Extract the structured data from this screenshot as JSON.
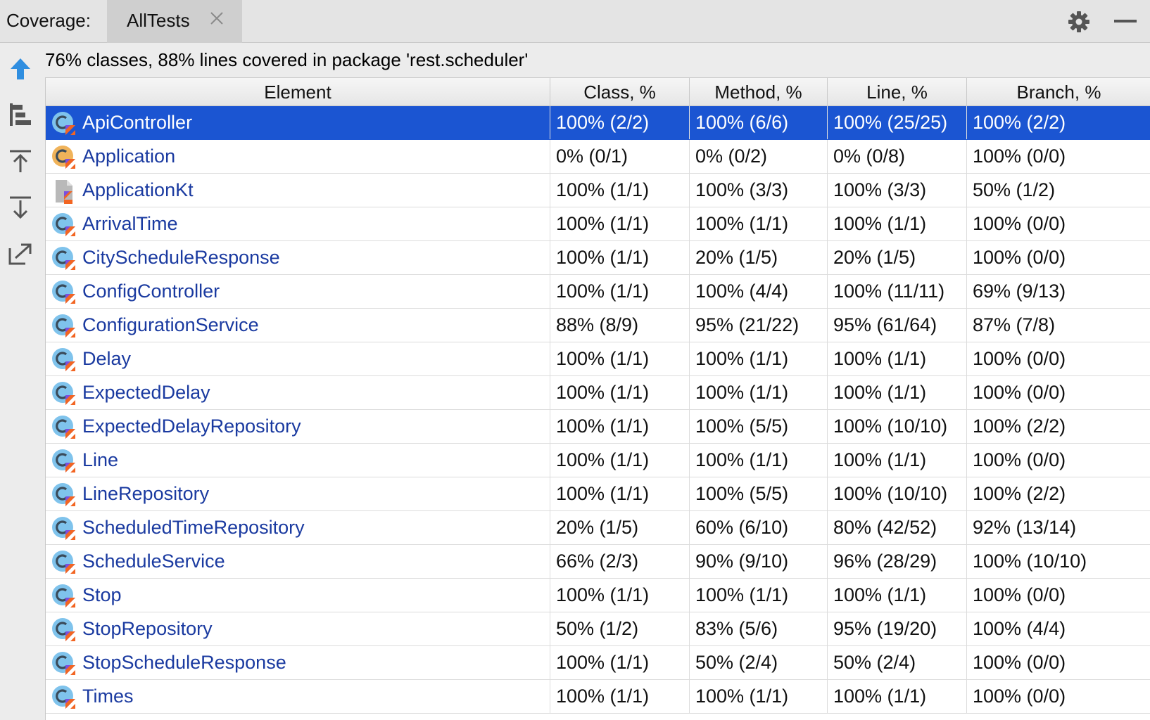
{
  "header": {
    "title": "Coverage:",
    "tab_label": "AllTests"
  },
  "icons": {
    "tab_close": "close-icon",
    "settings": "gear-icon",
    "minimize": "minimize-icon",
    "toolbar": [
      "arrow-up-icon",
      "flatten-packages-icon",
      "autoscroll-to-source-icon",
      "autoscroll-from-source-icon",
      "export-icon"
    ]
  },
  "summary": "76% classes, 88% lines covered in package 'rest.scheduler'",
  "table": {
    "columns": [
      "Element",
      "Class, %",
      "Method, %",
      "Line, %",
      "Branch, %"
    ],
    "rows": [
      {
        "name": "ApiController",
        "kind": "class",
        "cls": "100% (2/2)",
        "method": "100% (6/6)",
        "line": "100% (25/25)",
        "branch": "100% (2/2)",
        "selected": true
      },
      {
        "name": "Application",
        "kind": "uncovered-class",
        "cls": "0% (0/1)",
        "method": "0% (0/2)",
        "line": "0% (0/8)",
        "branch": "100% (0/0)"
      },
      {
        "name": "ApplicationKt",
        "kind": "file",
        "cls": "100% (1/1)",
        "method": "100% (3/3)",
        "line": "100% (3/3)",
        "branch": "50% (1/2)"
      },
      {
        "name": "ArrivalTime",
        "kind": "class",
        "cls": "100% (1/1)",
        "method": "100% (1/1)",
        "line": "100% (1/1)",
        "branch": "100% (0/0)"
      },
      {
        "name": "CityScheduleResponse",
        "kind": "class",
        "cls": "100% (1/1)",
        "method": "20% (1/5)",
        "line": "20% (1/5)",
        "branch": "100% (0/0)"
      },
      {
        "name": "ConfigController",
        "kind": "class",
        "cls": "100% (1/1)",
        "method": "100% (4/4)",
        "line": "100% (11/11)",
        "branch": "69% (9/13)"
      },
      {
        "name": "ConfigurationService",
        "kind": "class",
        "cls": "88% (8/9)",
        "method": "95% (21/22)",
        "line": "95% (61/64)",
        "branch": "87% (7/8)"
      },
      {
        "name": "Delay",
        "kind": "class",
        "cls": "100% (1/1)",
        "method": "100% (1/1)",
        "line": "100% (1/1)",
        "branch": "100% (0/0)"
      },
      {
        "name": "ExpectedDelay",
        "kind": "class",
        "cls": "100% (1/1)",
        "method": "100% (1/1)",
        "line": "100% (1/1)",
        "branch": "100% (0/0)"
      },
      {
        "name": "ExpectedDelayRepository",
        "kind": "class",
        "cls": "100% (1/1)",
        "method": "100% (5/5)",
        "line": "100% (10/10)",
        "branch": "100% (2/2)"
      },
      {
        "name": "Line",
        "kind": "class",
        "cls": "100% (1/1)",
        "method": "100% (1/1)",
        "line": "100% (1/1)",
        "branch": "100% (0/0)"
      },
      {
        "name": "LineRepository",
        "kind": "class",
        "cls": "100% (1/1)",
        "method": "100% (5/5)",
        "line": "100% (10/10)",
        "branch": "100% (2/2)"
      },
      {
        "name": "ScheduledTimeRepository",
        "kind": "class",
        "cls": "20% (1/5)",
        "method": "60% (6/10)",
        "line": "80% (42/52)",
        "branch": "92% (13/14)"
      },
      {
        "name": "ScheduleService",
        "kind": "class",
        "cls": "66% (2/3)",
        "method": "90% (9/10)",
        "line": "96% (28/29)",
        "branch": "100% (10/10)"
      },
      {
        "name": "Stop",
        "kind": "class",
        "cls": "100% (1/1)",
        "method": "100% (1/1)",
        "line": "100% (1/1)",
        "branch": "100% (0/0)"
      },
      {
        "name": "StopRepository",
        "kind": "class",
        "cls": "50% (1/2)",
        "method": "83% (5/6)",
        "line": "95% (19/20)",
        "branch": "100% (4/4)"
      },
      {
        "name": "StopScheduleResponse",
        "kind": "class",
        "cls": "100% (1/1)",
        "method": "50% (2/4)",
        "line": "50% (2/4)",
        "branch": "100% (0/0)"
      },
      {
        "name": "Times",
        "kind": "class",
        "cls": "100% (1/1)",
        "method": "100% (1/1)",
        "line": "100% (1/1)",
        "branch": "100% (0/0)"
      }
    ]
  },
  "colors": {
    "selection": "#1b55d2",
    "link_text": "#1a3aa0",
    "class_icon": "#7fc3ec",
    "uncovered_icon": "#f0b35a",
    "kotlin_orange": "#f26522",
    "kotlin_purple": "#7b4fe0",
    "arrow_blue": "#2f8ee0"
  }
}
